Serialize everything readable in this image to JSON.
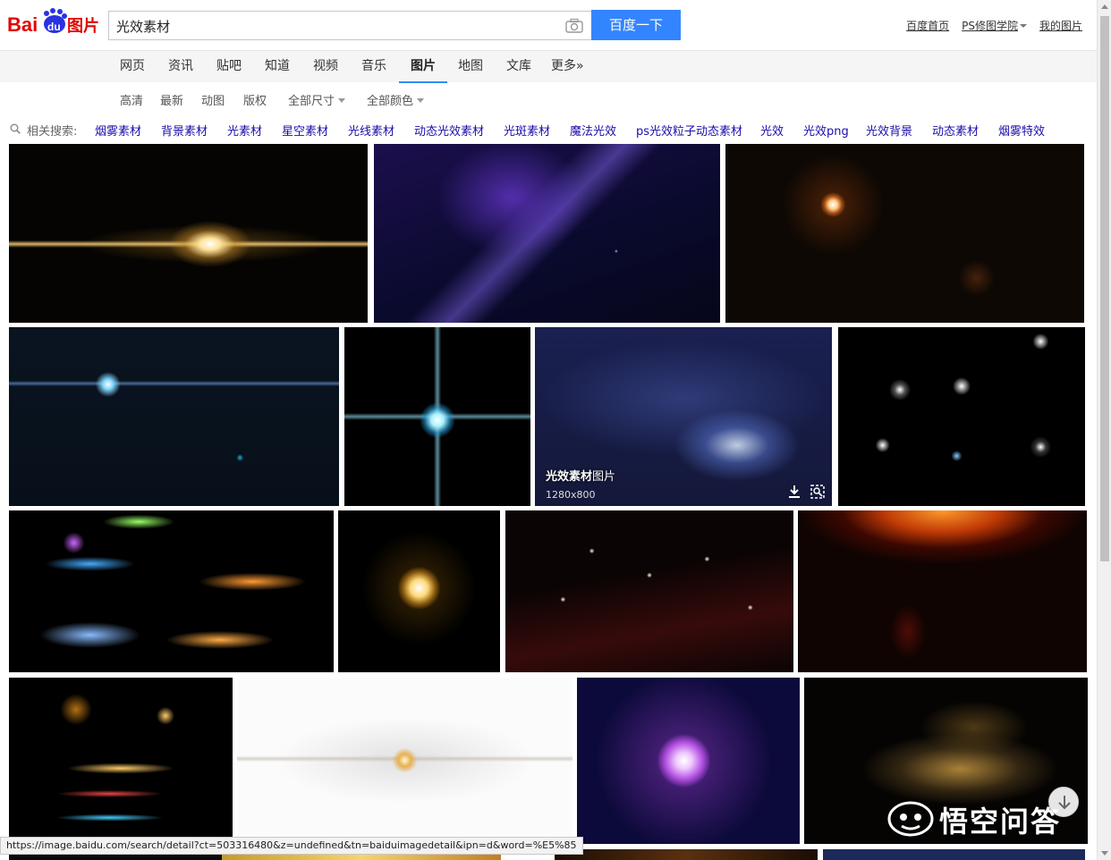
{
  "logo": {
    "text_bai": "Bai",
    "text_du": "du",
    "text_cn": "图片"
  },
  "search": {
    "query": "光效素材",
    "button": "百度一下"
  },
  "toplinks": [
    "百度首页",
    "PS修图学院",
    "我的图片"
  ],
  "nav": [
    "网页",
    "资讯",
    "贴吧",
    "知道",
    "视频",
    "音乐",
    "图片",
    "地图",
    "文库",
    "更多»"
  ],
  "nav_active": "图片",
  "filters": [
    "高清",
    "最新",
    "动图",
    "版权",
    "全部尺寸",
    "全部颜色"
  ],
  "related": {
    "label": "相关搜索:",
    "links": [
      "烟雾素材",
      "背景素材",
      "光素材",
      "星空素材",
      "光线素材",
      "动态光效素材",
      "光斑素材",
      "魔法光效",
      "ps光效粒子动态素材",
      "光效",
      "光效png",
      "光效背景",
      "动态素材",
      "烟雾特效"
    ]
  },
  "hover_tile": {
    "title_bold": "光效素材",
    "title_rest": "图片",
    "size": "1280x800"
  },
  "status_url": "https://image.baidu.com/search/detail?ct=503316480&z=undefined&tn=baiduimagedetail&ipn=d&word=%E5%85",
  "watermark": "悟空问答",
  "colors": {
    "accent": "#3385ff",
    "link": "#1a0dab",
    "logo_red": "#e10601",
    "logo_blue": "#2932e1"
  }
}
